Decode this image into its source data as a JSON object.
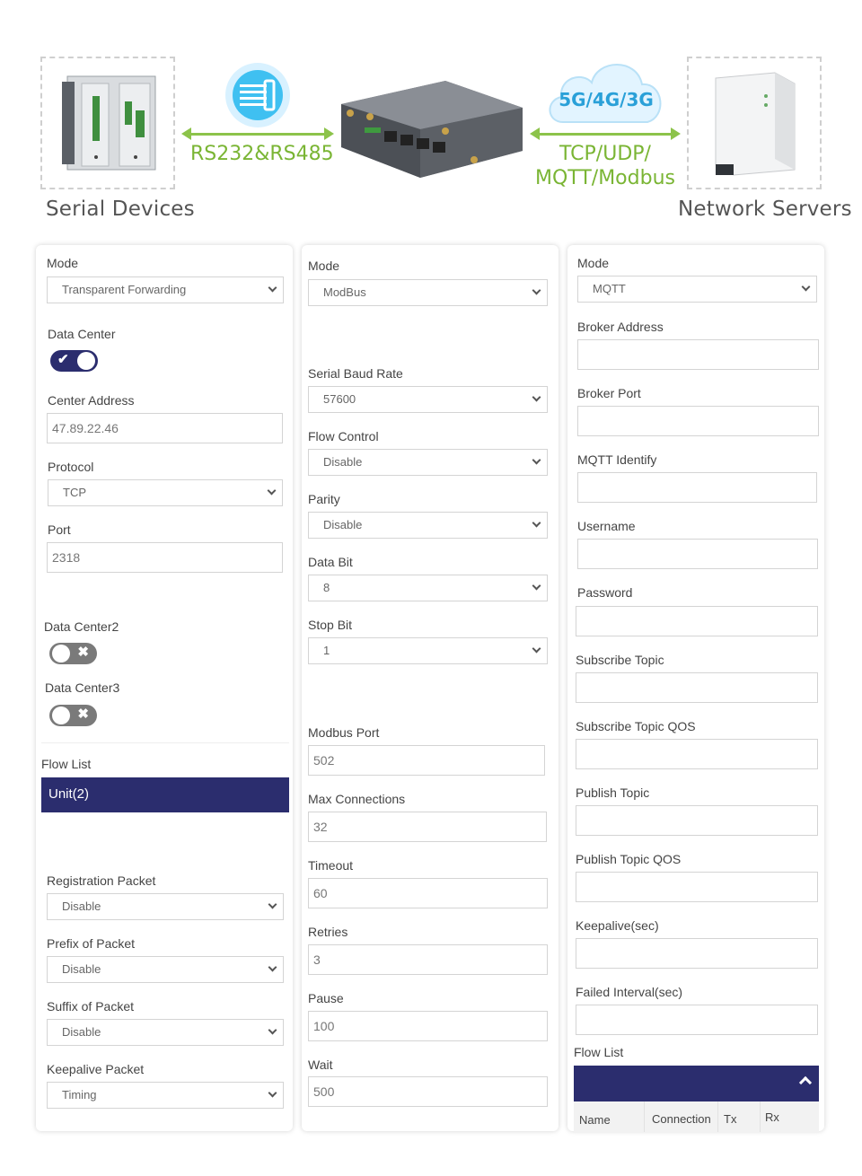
{
  "diagram": {
    "serial_devices_label": "Serial Devices",
    "network_servers_label": "Network Servers",
    "serial_protocol_label": "RS232&RS485",
    "network_protocol_line1": "TCP/UDP/",
    "network_protocol_line2": "MQTT/Modbus",
    "cloud_label": "5G/4G/3G",
    "accent_color": "#7ab534",
    "cloud_color": "#2aa0d8"
  },
  "panel1": {
    "mode_label": "Mode",
    "mode_value": "Transparent Forwarding",
    "data_center_label": "Data Center",
    "center_address_label": "Center Address",
    "center_address_value": "47.89.22.46",
    "protocol_label": "Protocol",
    "protocol_value": "TCP",
    "port_label": "Port",
    "port_value": "2318",
    "data_center2_label": "Data Center2",
    "data_center3_label": "Data Center3",
    "flow_list_label": "Flow List",
    "flow_unit": "Unit(2)",
    "registration_packet_label": "Registration Packet",
    "registration_packet_value": "Disable",
    "prefix_label": "Prefix of Packet",
    "prefix_value": "Disable",
    "suffix_label": "Suffix of Packet",
    "suffix_value": "Disable",
    "keepalive_packet_label": "Keepalive Packet",
    "keepalive_packet_value": "Timing"
  },
  "panel2": {
    "mode_label": "Mode",
    "mode_value": "ModBus",
    "baud_label": "Serial Baud Rate",
    "baud_value": "57600",
    "flow_control_label": "Flow Control",
    "flow_control_value": "Disable",
    "parity_label": "Parity",
    "parity_value": "Disable",
    "data_bit_label": "Data Bit",
    "data_bit_value": "8",
    "stop_bit_label": "Stop Bit",
    "stop_bit_value": "1",
    "modbus_port_label": "Modbus Port",
    "modbus_port_value": "502",
    "max_conn_label": "Max Connections",
    "max_conn_value": "32",
    "timeout_label": "Timeout",
    "timeout_value": "60",
    "retries_label": "Retries",
    "retries_value": "3",
    "pause_label": "Pause",
    "pause_value": "100",
    "wait_label": "Wait",
    "wait_value": "500"
  },
  "panel3": {
    "mode_label": "Mode",
    "mode_value": "MQTT",
    "broker_address_label": "Broker Address",
    "broker_port_label": "Broker Port",
    "mqtt_identify_label": "MQTT Identify",
    "username_label": "Username",
    "password_label": "Password",
    "subscribe_topic_label": "Subscribe Topic",
    "subscribe_qos_label": "Subscribe Topic QOS",
    "publish_topic_label": "Publish Topic",
    "publish_qos_label": "Publish Topic QOS",
    "keepalive_label": "Keepalive(sec)",
    "failed_interval_label": "Failed Interval(sec)",
    "flow_list_label": "Flow List",
    "table_headers": [
      "Name",
      "Connection",
      "Tx",
      "Rx"
    ]
  },
  "theme": {
    "primary": "#2b2d6e",
    "toggle_off": "#7a7a7a"
  }
}
